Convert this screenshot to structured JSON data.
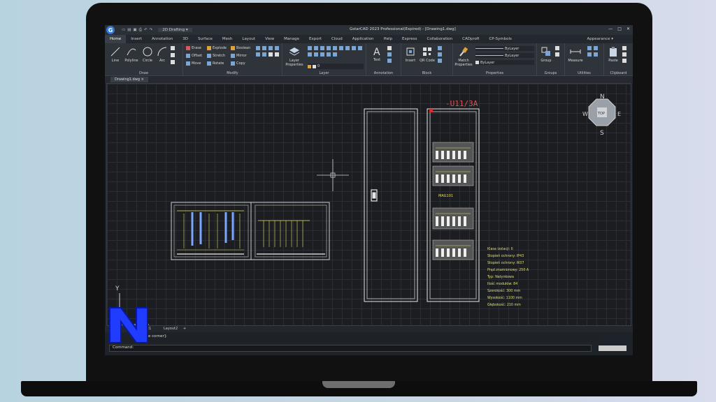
{
  "app": {
    "logo_letter": "G",
    "title": "GstarCAD 2023 Professional(Expired) - [Drawing1.dwg]",
    "workspace": "2D Drafting",
    "appearance": "Appearance",
    "window_buttons": [
      "—",
      "□",
      "✕"
    ]
  },
  "menu": {
    "tabs": [
      "Home",
      "Insert",
      "Annotation",
      "3D",
      "Surface",
      "Mesh",
      "Layout",
      "View",
      "Manage",
      "Export",
      "Cloud",
      "Application",
      "Help",
      "Express",
      "Collaboration",
      "CADprofi",
      "CP-Symbols"
    ],
    "active": "Home"
  },
  "ribbon": {
    "draw": {
      "label": "Draw",
      "line": "Line",
      "polyline": "Polyline",
      "circle": "Circle",
      "arc": "Arc"
    },
    "modify": {
      "label": "Modify",
      "erase": "Erase",
      "explode": "Explode",
      "boolean": "Boolean",
      "offset": "Offset",
      "stretch": "Stretch",
      "mirror": "Mirror",
      "move": "Move",
      "rotate": "Rotate",
      "copy": "Copy"
    },
    "layer": {
      "label": "Layer",
      "properties": "Layer Properties",
      "layer_value": "0"
    },
    "annotation": {
      "label": "Annotation",
      "text": "Text"
    },
    "block": {
      "label": "Block",
      "insert": "Insert",
      "qr": "QR Code"
    },
    "properties": {
      "label": "Properties",
      "match": "Match Properties",
      "bylayer1": "ByLayer",
      "bylayer2": "ByLayer",
      "bylayer3": "ByLayer"
    },
    "groups": {
      "label": "Groups",
      "group": "Group"
    },
    "utilities": {
      "label": "Utilities",
      "measure": "Measure"
    },
    "clipboard": {
      "label": "Clipboard",
      "paste": "Paste"
    }
  },
  "document": {
    "tab": "Drawing1.dwg"
  },
  "drawing": {
    "cabinet_label": "-U11/3A",
    "module_label": "MAG101",
    "specs": [
      "Klasa izolacji: II",
      "Stopień ochrony: IP43",
      "Stopień ochrony: IK07",
      "Prąd znamionowy: 250 A",
      "Typ: Natynkowa",
      "Ilość modułów: 84",
      "Szerokość: 300 mm",
      "Wysokość: 1100 mm",
      "Głębokość: 210 mm"
    ],
    "ucs_y": "Y",
    "compass": {
      "n": "N",
      "s": "S",
      "e": "E",
      "w": "W",
      "center": "TOP"
    }
  },
  "layouts": {
    "tabs": [
      "...out1",
      "Layout2",
      "+"
    ]
  },
  "command": {
    "history": "e corner]:",
    "prompt": "Command:"
  },
  "colors": {
    "brand_blue": "#2f7ad6",
    "overlay_blue": "#1f3cff"
  }
}
